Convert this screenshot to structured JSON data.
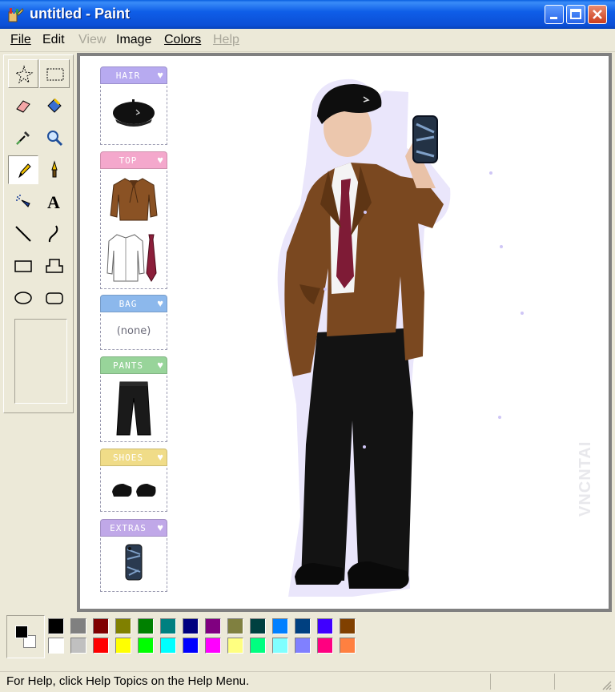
{
  "window": {
    "title": "untitled - Paint",
    "app_icon": "paint-app-icon",
    "controls": [
      "minimize-icon",
      "maximize-icon",
      "close-icon"
    ]
  },
  "menubar": {
    "items": [
      {
        "label": "File",
        "disabled": false
      },
      {
        "label": "Edit",
        "disabled": false
      },
      {
        "label": "View",
        "disabled": true
      },
      {
        "label": "Image",
        "disabled": false
      },
      {
        "label": "Colors",
        "disabled": false
      },
      {
        "label": "Help",
        "disabled": true
      }
    ]
  },
  "toolbox": {
    "tools": [
      {
        "name": "free-form-select",
        "icon": "star-select-icon",
        "state": "pressed"
      },
      {
        "name": "select",
        "icon": "rect-select-icon",
        "state": "pressed"
      },
      {
        "name": "eraser",
        "icon": "eraser-icon",
        "state": "normal"
      },
      {
        "name": "fill",
        "icon": "paint-bucket-icon",
        "state": "normal"
      },
      {
        "name": "pick-color",
        "icon": "eyedropper-icon",
        "state": "normal"
      },
      {
        "name": "magnifier",
        "icon": "magnifier-icon",
        "state": "normal"
      },
      {
        "name": "pencil",
        "icon": "pencil-icon",
        "state": "active"
      },
      {
        "name": "brush",
        "icon": "brush-icon",
        "state": "normal"
      },
      {
        "name": "airbrush",
        "icon": "airbrush-icon",
        "state": "normal"
      },
      {
        "name": "text",
        "icon": "text-icon",
        "state": "normal"
      },
      {
        "name": "line",
        "icon": "line-icon",
        "state": "normal"
      },
      {
        "name": "curve",
        "icon": "curve-icon",
        "state": "normal"
      },
      {
        "name": "rectangle",
        "icon": "rectangle-icon",
        "state": "normal"
      },
      {
        "name": "polygon",
        "icon": "polygon-icon",
        "state": "normal"
      },
      {
        "name": "ellipse",
        "icon": "ellipse-icon",
        "state": "normal"
      },
      {
        "name": "rounded-rectangle",
        "icon": "rounded-rect-icon",
        "state": "normal"
      }
    ]
  },
  "outfit": {
    "panels": [
      {
        "label": "HAIR",
        "color": "#b7aaf0",
        "items": [
          "beret-icon"
        ]
      },
      {
        "label": "TOP",
        "color": "#f4a8cc",
        "items": [
          "brown-jacket-icon",
          "white-shirt-icon",
          "red-tie-icon"
        ]
      },
      {
        "label": "BAG",
        "color": "#8cb8ec",
        "items": [],
        "empty_text": "(none)"
      },
      {
        "label": "PANTS",
        "color": "#98d49a",
        "items": [
          "black-trousers-icon"
        ]
      },
      {
        "label": "SHOES",
        "color": "#f0dc88",
        "items": [
          "black-shoes-icon"
        ]
      },
      {
        "label": "EXTRAS",
        "color": "#c0a8e8",
        "items": [
          "phone-case-icon"
        ]
      }
    ],
    "heart_glyph": "♥"
  },
  "canvas": {
    "watermark": "VNCNTAI"
  },
  "palette": {
    "foreground": "#000000",
    "background": "#ffffff",
    "top_row": [
      "#000000",
      "#808080",
      "#800000",
      "#808000",
      "#008000",
      "#008080",
      "#000080",
      "#800080",
      "#808040",
      "#004040",
      "#0080ff",
      "#004080",
      "#4000ff",
      "#804000"
    ],
    "bottom_row": [
      "#ffffff",
      "#c0c0c0",
      "#ff0000",
      "#ffff00",
      "#00ff00",
      "#00ffff",
      "#0000ff",
      "#ff00ff",
      "#ffff80",
      "#00ff80",
      "#80ffff",
      "#8080ff",
      "#ff0080",
      "#ff8040"
    ]
  },
  "statusbar": {
    "text": "For Help, click Help Topics on the Help Menu."
  }
}
